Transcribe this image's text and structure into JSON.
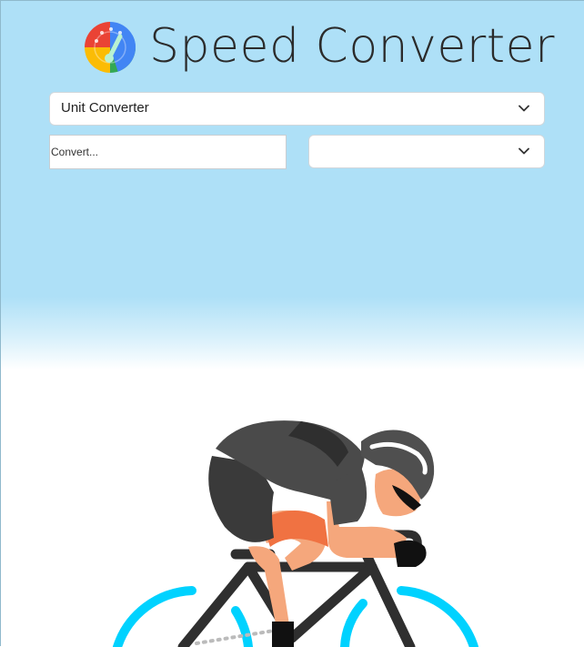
{
  "app": {
    "title": "Speed Converter",
    "logo_icon": "speedometer-icon",
    "colors": {
      "sky": "#aee0f7",
      "title_text": "#2b2b2b",
      "wheel_accent": "#00d2ff"
    }
  },
  "converter": {
    "mode_select": {
      "value": "Unit Converter",
      "icon": "chevron-down-icon"
    },
    "input": {
      "placeholder": "Convert...",
      "value": ""
    },
    "target_select": {
      "value": "",
      "icon": "chevron-down-icon"
    }
  },
  "illustration": {
    "subject": "cyclist-illustration"
  }
}
